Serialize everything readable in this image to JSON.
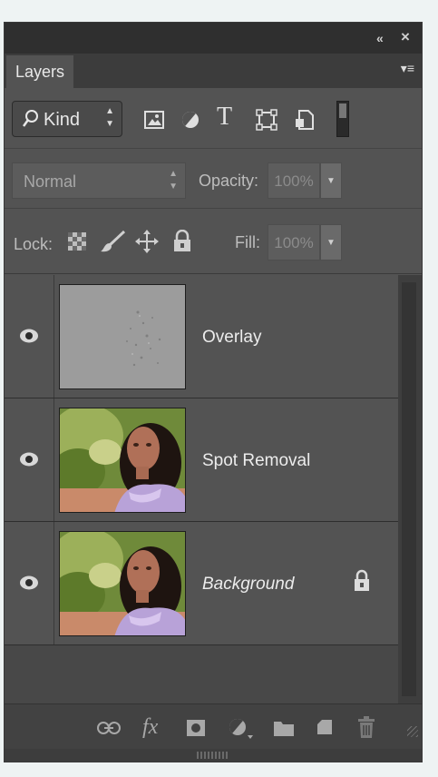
{
  "window": {
    "collapse_glyph": "«",
    "close_glyph": "×"
  },
  "tab": {
    "label": "Layers",
    "menu_glyph": "▾≡"
  },
  "filter": {
    "kind_label": "Kind",
    "icons": [
      "pixel-filter-icon",
      "adjustment-filter-icon",
      "type-filter-icon",
      "shape-filter-icon",
      "smart-object-filter-icon"
    ],
    "type_glyph": "T"
  },
  "blend": {
    "mode": "Normal",
    "opacity_label": "Opacity:",
    "opacity_value": "100%"
  },
  "lock": {
    "label": "Lock:",
    "fill_label": "Fill:",
    "fill_value": "100%"
  },
  "layers": [
    {
      "name": "Overlay",
      "visible": true,
      "locked": false,
      "thumbnail": "gray-texture"
    },
    {
      "name": "Spot Removal",
      "visible": true,
      "locked": false,
      "thumbnail": "woman-portrait"
    },
    {
      "name": "Background",
      "visible": true,
      "locked": true,
      "thumbnail": "woman-portrait"
    }
  ],
  "bottom_toolbar": {
    "fx_label": "fx",
    "icons": [
      "link-layers-icon",
      "fx-icon",
      "mask-icon",
      "adjustment-layer-icon",
      "new-group-icon",
      "new-layer-icon",
      "trash-icon"
    ]
  },
  "colors": {
    "panel_bg": "#535353",
    "titlebar_bg": "#2f2f2f",
    "text": "#ececec"
  }
}
